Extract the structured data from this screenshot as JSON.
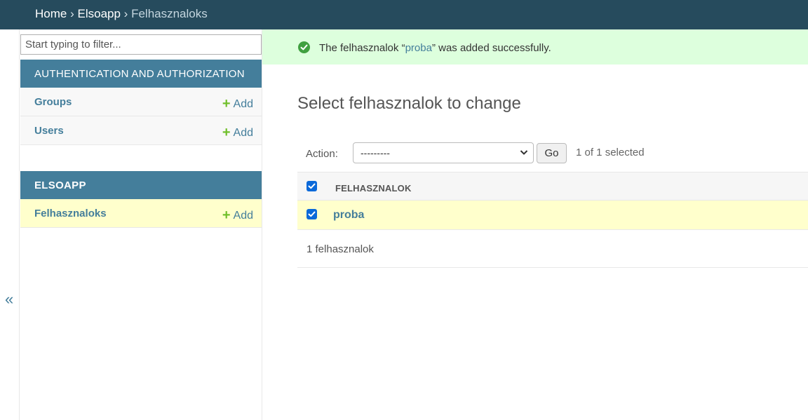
{
  "breadcrumb": {
    "home": "Home",
    "separator": "›",
    "app": "Elsoapp",
    "current": "Felhasznaloks"
  },
  "sidebar": {
    "toggle_icon": "«",
    "filter_placeholder": "Start typing to filter...",
    "modules": [
      {
        "caption": "AUTHENTICATION AND AUTHORIZATION",
        "models": [
          {
            "name": "Groups",
            "add_label": "Add"
          },
          {
            "name": "Users",
            "add_label": "Add"
          }
        ]
      },
      {
        "caption": "ELSOAPP",
        "models": [
          {
            "name": "Felhasznaloks",
            "add_label": "Add",
            "selected": true
          }
        ]
      }
    ]
  },
  "message": {
    "icon": "success-check-icon",
    "prefix": "The felhasznalok “",
    "object_link": "proba",
    "suffix": "” was added successfully."
  },
  "main": {
    "title": "Select felhasznalok to change",
    "action_label": "Action:",
    "action_value": "---------",
    "go_label": "Go",
    "selected_text": "1 of 1 selected",
    "column_header": "FELHASZNALOK",
    "header_checked": true,
    "rows": [
      {
        "label": "proba",
        "checked": true
      }
    ],
    "paginator": "1 felhasznalok"
  },
  "colors": {
    "header_bg": "#264b5d",
    "module_caption_bg": "#447e9b",
    "link": "#447e9b",
    "success_bg": "#ddffdd",
    "selected_row_bg": "#ffffcc",
    "add_plus": "#70bf2b",
    "checkbox": "#0b69d9"
  }
}
